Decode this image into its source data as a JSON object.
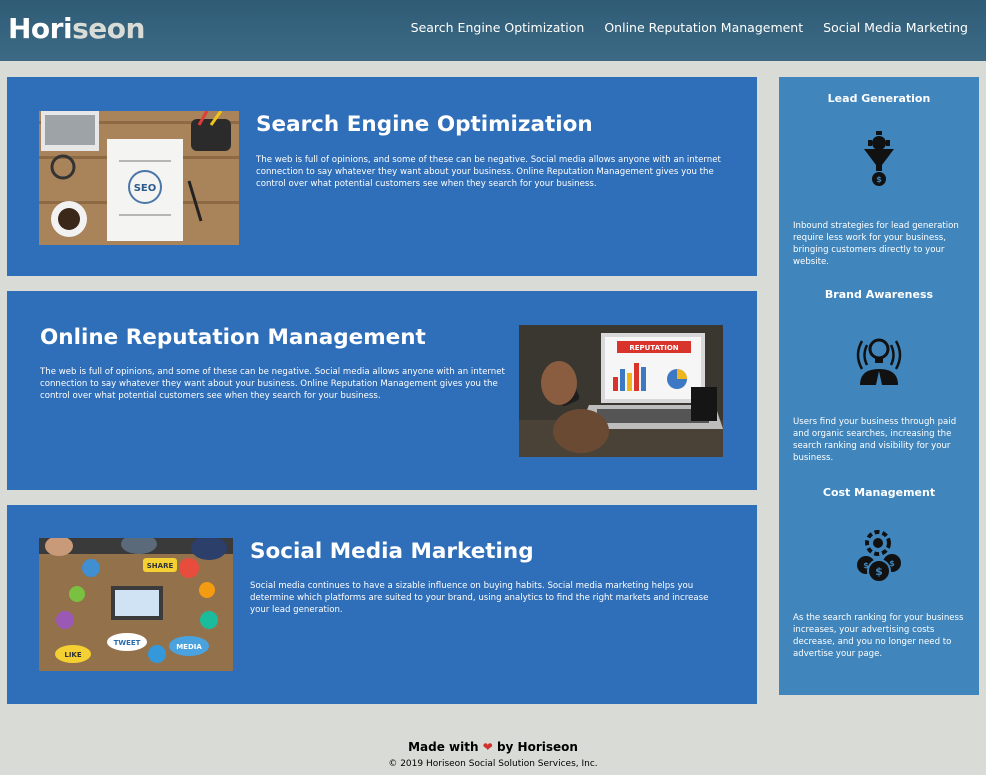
{
  "header": {
    "logo_part1": "Hori",
    "logo_part2": "seon",
    "nav": [
      {
        "label": "Search Engine Optimization"
      },
      {
        "label": "Online Reputation Management"
      },
      {
        "label": "Social Media Marketing"
      }
    ]
  },
  "content": [
    {
      "title": "Search Engine Optimization",
      "text": "The web is full of opinions, and some of these can be negative. Social media allows anyone with an internet connection to say whatever they want about your business. Online Reputation Management gives you the control over what potential customers see when they search for your business.",
      "image_caption": "SEO"
    },
    {
      "title": "Online Reputation Management",
      "text": "The web is full of opinions, and some of these can be negative. Social media allows anyone with an internet connection to say whatever they want about your business. Online Reputation Management gives you the control over what potential customers see when they search for your business.",
      "image_caption": "REPUTATION"
    },
    {
      "title": "Social Media Marketing",
      "text": "Social media continues to have a sizable influence on buying habits. Social media marketing helps you determine which platforms are suited to your brand, using analytics to find the right markets and increase your lead generation.",
      "image_labels": [
        "SHARE",
        "TWEET",
        "LIKE",
        "MEDIA"
      ]
    }
  ],
  "benefits": [
    {
      "title": "Lead Generation",
      "icon": "lead-generation-icon",
      "text": "Inbound strategies for lead generation require less work for your business, bringing customers directly to your website."
    },
    {
      "title": "Brand Awareness",
      "icon": "brand-awareness-icon",
      "text": "Users find your business through paid and organic searches, increasing the search ranking and visibility for your business."
    },
    {
      "title": "Cost Management",
      "icon": "cost-management-icon",
      "text": "As the search ranking for your business increases, your advertising costs decrease, and you no longer need to advertise your page."
    }
  ],
  "footer": {
    "made_prefix": "Made with",
    "made_suffix": "by Horiseon",
    "copyright": "© 2019 Horiseon Social Solution Services, Inc."
  },
  "colors": {
    "header_bg": "#2f5b75",
    "page_bg": "#d9dcd6",
    "card_bg": "#2f6eb8",
    "sidebar_bg": "#4086bd"
  }
}
